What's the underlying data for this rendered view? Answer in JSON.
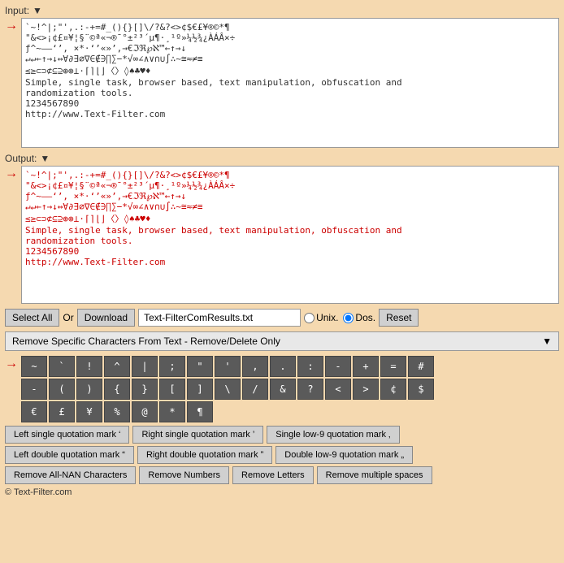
{
  "input": {
    "label": "Input:",
    "dropdown_symbol": "▼",
    "text": "`~!^|;\"',.:-+=#_(){}[]\\/?&?<>¢$€£¥®©*¶\n\"&<>¡¢£¤¥¦§¨©ª«¬­®¯°±²³´µ¶·¸¹º»¼½¾¿ÀÁÂ×÷\nƒ^~—–‘’, ×*·‘’«»’‚→€ℑℜ℘ℵ™←↑→↓\n↵↵←↑→↓↔∀∂∃∅∇∈∉∋∏∑−*√∞∠∧∨∩∪∫∴~≅≈≠≡\n≤≥⊂⊃⊄⊆⊇⊕⊗⊥·⌈⌉⌊⌋〈〉◊♠♣♥♦\nSimple, single task, browser based, text manipulation, obfuscation and\nrandomization tools.\n1234567890\nhttp://www.Text-Filter.com"
  },
  "output": {
    "label": "Output:",
    "dropdown_symbol": "▼",
    "text": "`~!^|;\"',.:-+=#_(){}[]\\/?&?<>¢$€£¥®©*¶\n\"&<>¡¢£¤¥¦§¨©ª«¬­®¯°±²³´µ¶·¸¹º»¼½¾¿ÀÁÂ×÷\nƒ^~—–‘’, ×*·‘’«»’‚→€ℑℜ℘ℵ™←↑→↓\n↵↵←↑→↓↔∀∂∃∅∇∈∉∋∏∑−*√∞∠∧∨∩∪∫∴~≅≈≠≡\n≤≥⊂⊃⊄⊆⊇⊕⊗⊥·⌈⌉⌊⌋〈〉◊♠♣♥♦\nSimple, single task, browser based, text manipulation, obfuscation and\nrandomization tools.\n1234567890\nhttp://www.Text-Filter.com"
  },
  "toolbar": {
    "select_all_label": "Select All",
    "or_label": "Or",
    "download_label": "Download",
    "filename_value": "Text-FilterComResults.txt",
    "unix_label": "Unix.",
    "dos_label": "Dos.",
    "reset_label": "Reset"
  },
  "dropdown_bar": {
    "label": "Remove Specific Characters From Text - Remove/Delete Only",
    "symbol": "▼"
  },
  "char_rows": [
    [
      "~",
      "`",
      "!",
      "^",
      "|",
      ";",
      "\"",
      "'",
      ",",
      ".",
      ":",
      "-",
      "+",
      "=",
      "#"
    ],
    [
      "-",
      "(",
      ")",
      "{",
      "}",
      "[",
      "]",
      "\\",
      "/",
      "&",
      "?",
      "<",
      ">",
      "¢",
      "$"
    ]
  ],
  "char_row2": [
    "€",
    "£",
    "¥",
    "%",
    "@",
    "*",
    "¶"
  ],
  "quote_buttons": [
    "Left single quotation mark ‘",
    "Right single quotation mark ’",
    "Single low-9 quotation mark ‚",
    "Left double quotation mark “",
    "Right double quotation mark ”",
    "Double low-9 quotation mark „"
  ],
  "action_buttons": [
    "Remove All-NAN Characters",
    "Remove Numbers",
    "Remove Letters",
    "Remove multiple spaces"
  ],
  "copyright": "© Text-Filter.com",
  "watermark": "Text-Filter.Com"
}
